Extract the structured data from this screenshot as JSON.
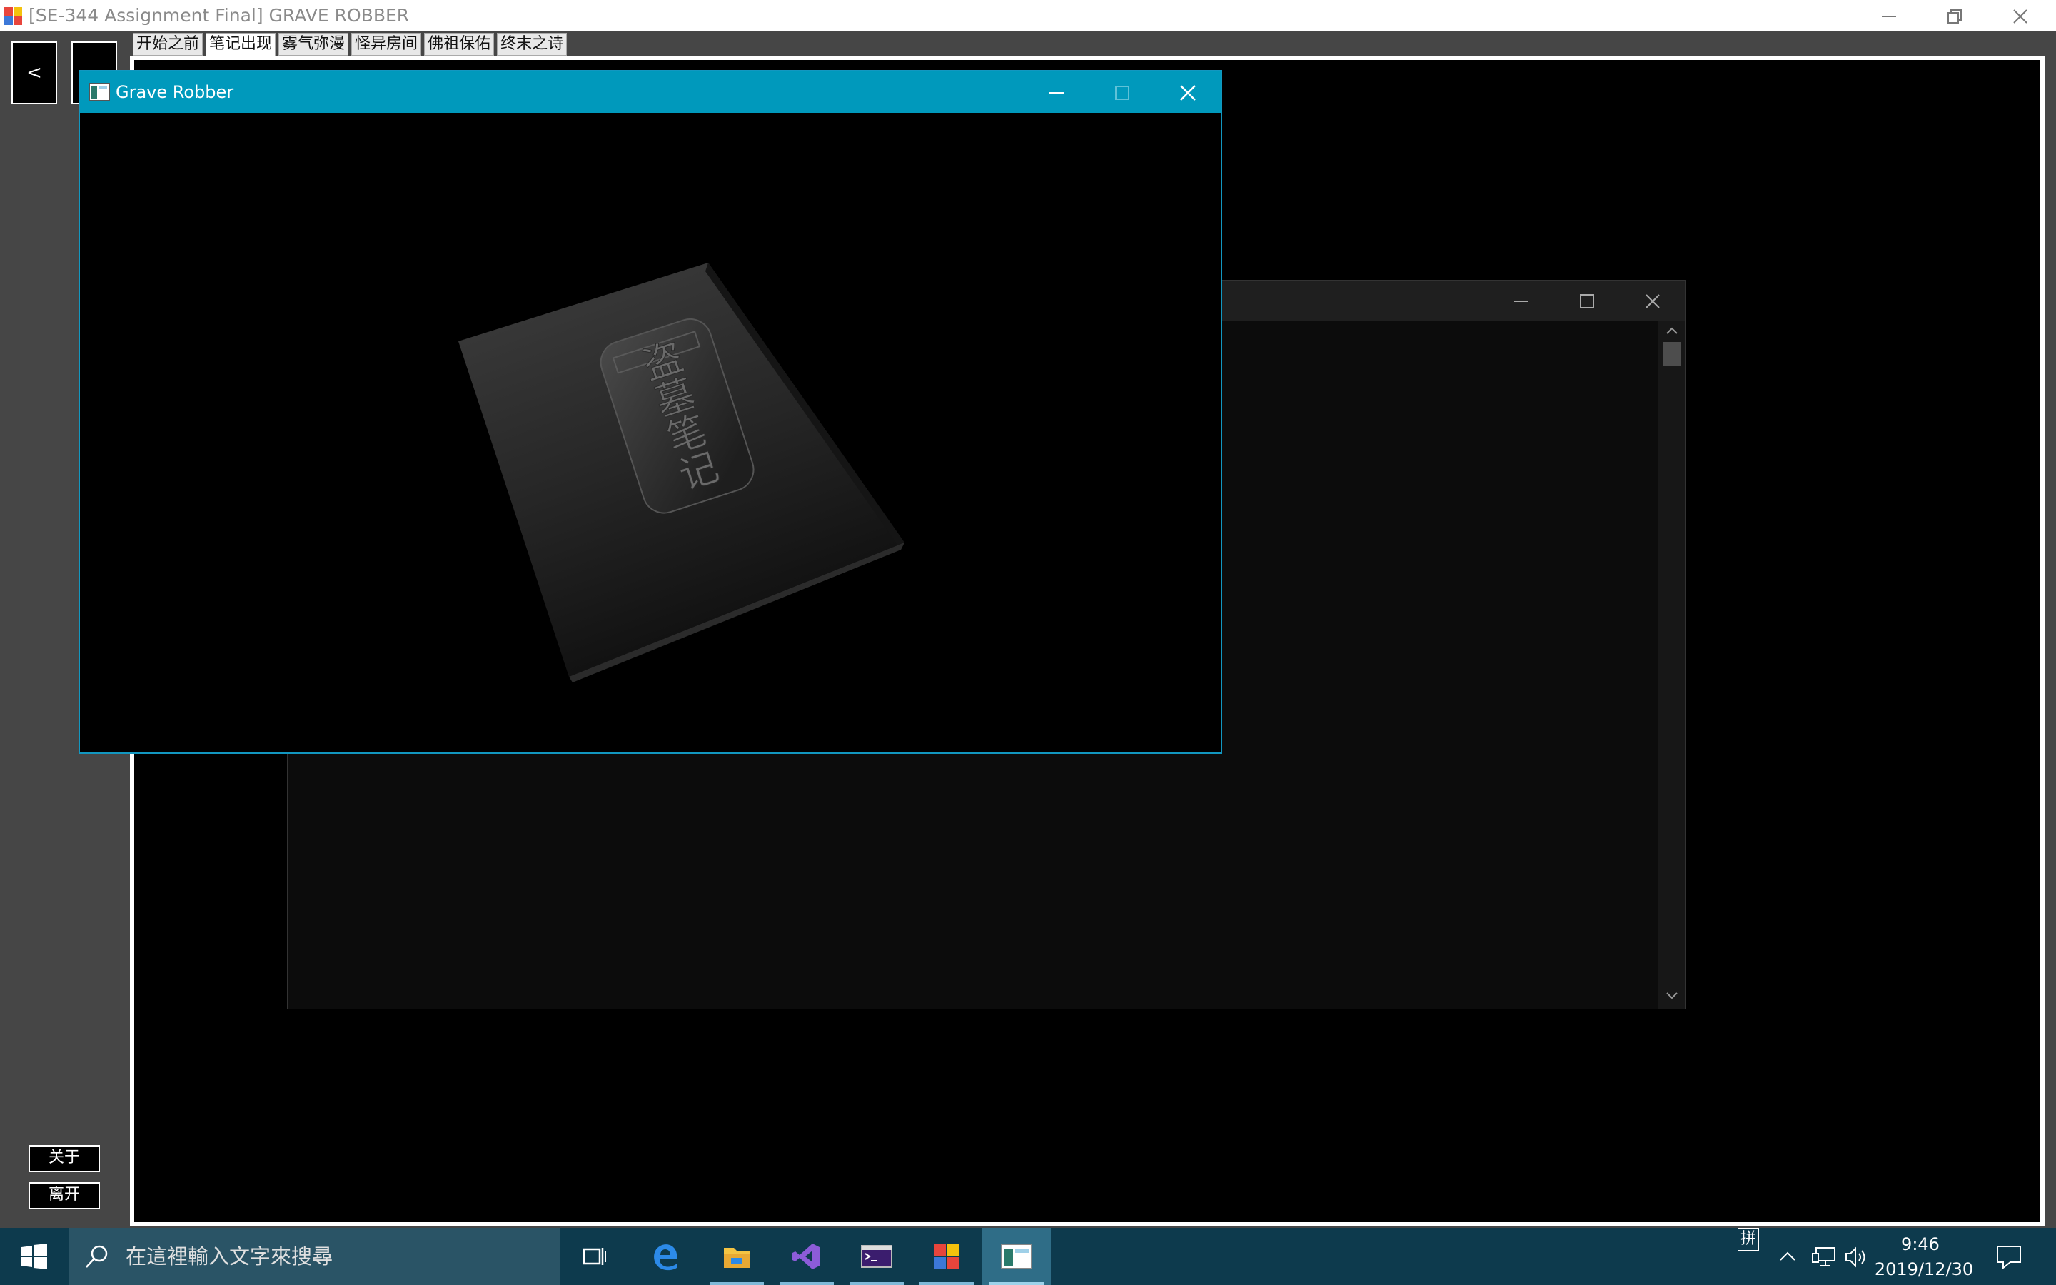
{
  "main_window": {
    "title": "[SE-344 Assignment Final] GRAVE ROBBER",
    "minimize_icon": "minimize-icon",
    "restore_icon": "restore-icon",
    "close_icon": "close-icon"
  },
  "nav": {
    "back_label": "<",
    "forward_label": ""
  },
  "tabs": [
    {
      "label": "开始之前",
      "active": false
    },
    {
      "label": "笔记出现",
      "active": true
    },
    {
      "label": "雾气弥漫",
      "active": false
    },
    {
      "label": "怪异房间",
      "active": false
    },
    {
      "label": "佛祖保佑",
      "active": false
    },
    {
      "label": "终末之诗",
      "active": false
    }
  ],
  "game_window": {
    "title": "Grave Robber",
    "book_title": "盗墓笔记"
  },
  "console_window": {
    "title": ""
  },
  "footer_buttons": {
    "about": "关于",
    "exit": "离开"
  },
  "taskbar": {
    "search_placeholder": "在這裡輸入文字來搜尋",
    "ime_indicator": "拼",
    "time": "9:46",
    "date": "2019/12/30",
    "icons": [
      "windows-start-icon",
      "search-icon",
      "task-view-icon",
      "edge-icon",
      "file-explorer-icon",
      "visual-studio-icon",
      "console-icon",
      "paint-app-icon",
      "grave-robber-app-icon",
      "chevron-up-icon",
      "network-icon",
      "speaker-icon",
      "notification-icon"
    ]
  },
  "colors": {
    "game_titlebar": "#0099bc",
    "taskbar": "#0d3a4d",
    "app_background": "#464646"
  }
}
